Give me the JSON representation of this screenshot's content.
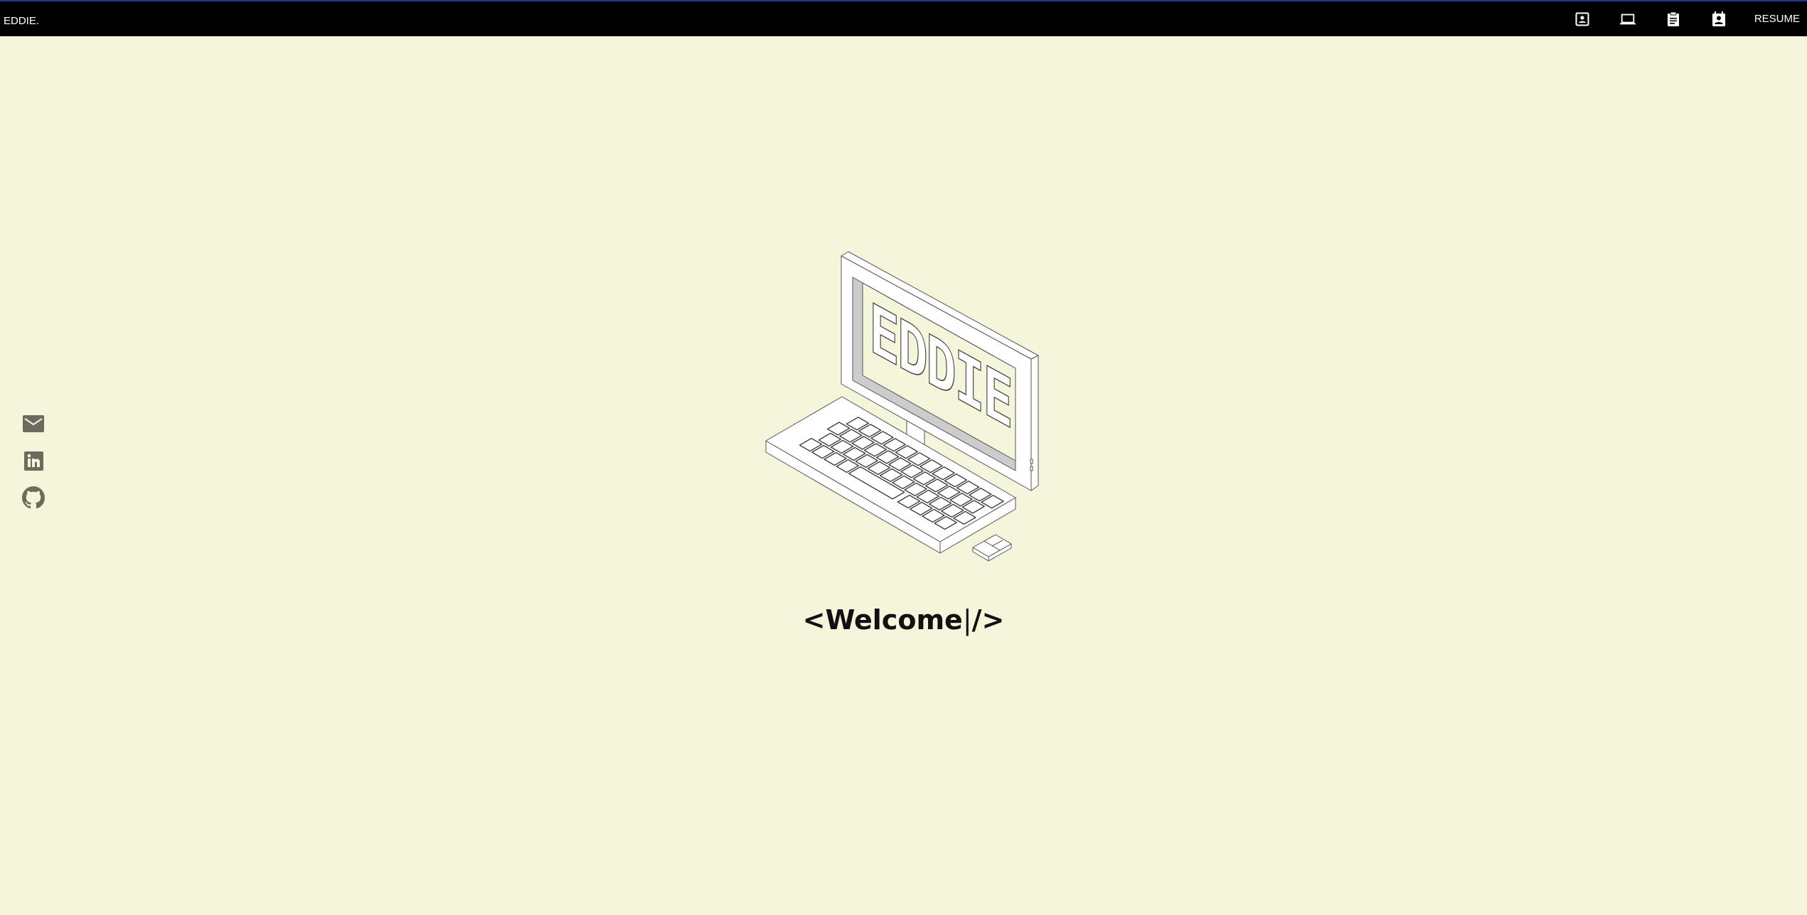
{
  "header": {
    "brand": "EDDIE.",
    "nav": [
      {
        "icon": "contact-icon"
      },
      {
        "icon": "laptop-icon"
      },
      {
        "icon": "clipboard-icon"
      },
      {
        "icon": "badge-icon"
      }
    ],
    "resume_label": "RESUME"
  },
  "social": [
    {
      "icon": "mail-icon"
    },
    {
      "icon": "linkedin-icon"
    },
    {
      "icon": "github-icon"
    }
  ],
  "hero": {
    "logo_text": "EDDIE",
    "welcome_open": "<Welcome",
    "cursor": "|",
    "welcome_close": "/>"
  },
  "colors": {
    "background": "#f5f5dc",
    "social_icon": "#6b6b5e",
    "topbar": "#000000"
  }
}
